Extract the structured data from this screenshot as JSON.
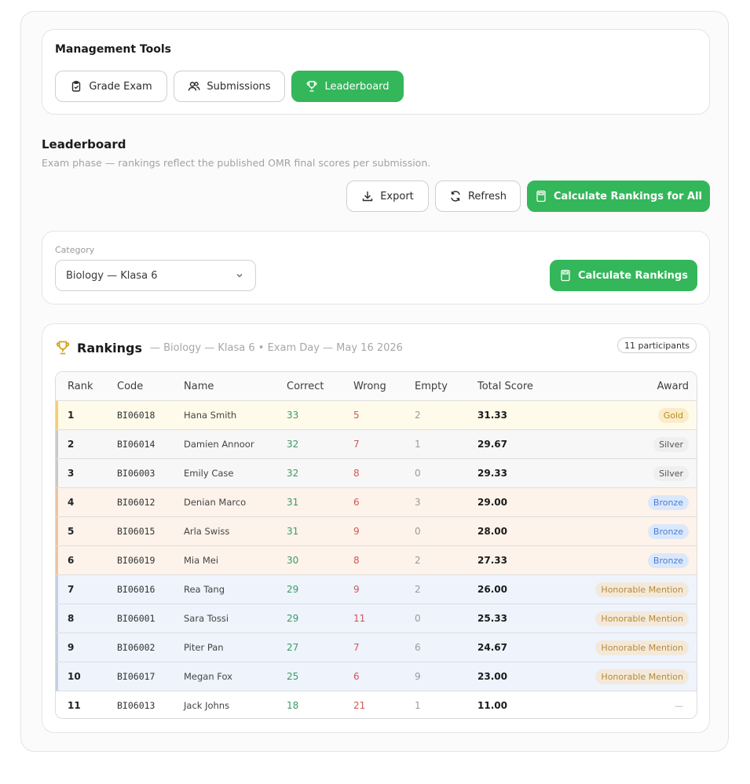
{
  "tools": {
    "title": "Management Tools",
    "grade_exam": "Grade Exam",
    "submissions": "Submissions",
    "leaderboard": "Leaderboard"
  },
  "leaderboard": {
    "title": "Leaderboard",
    "subtitle": "Exam phase — rankings reflect the published OMR final scores per submission.",
    "export": "Export",
    "refresh": "Refresh",
    "calc_all": "Calculate Rankings for All"
  },
  "category": {
    "label": "Category",
    "selected": "Biology — Klasa 6",
    "calc": "Calculate Rankings"
  },
  "rankings": {
    "title": "Rankings",
    "meta": "— Biology — Klasa 6 • Exam Day — May 16 2026",
    "participants": "11 participants",
    "columns": {
      "rank": "Rank",
      "code": "Code",
      "name": "Name",
      "correct": "Correct",
      "wrong": "Wrong",
      "empty": "Empty",
      "total": "Total Score",
      "award": "Award"
    },
    "rows": [
      {
        "rank": "1",
        "code": "BI06018",
        "name": "Hana Smith",
        "correct": "33",
        "wrong": "5",
        "empty": "2",
        "total": "31.33",
        "award": "Gold",
        "tier": "gold"
      },
      {
        "rank": "2",
        "code": "BI06014",
        "name": "Damien Annoor",
        "correct": "32",
        "wrong": "7",
        "empty": "1",
        "total": "29.67",
        "award": "Silver",
        "tier": "silver"
      },
      {
        "rank": "3",
        "code": "BI06003",
        "name": "Emily Case",
        "correct": "32",
        "wrong": "8",
        "empty": "0",
        "total": "29.33",
        "award": "Silver",
        "tier": "silver"
      },
      {
        "rank": "4",
        "code": "BI06012",
        "name": "Denian Marco",
        "correct": "31",
        "wrong": "6",
        "empty": "3",
        "total": "29.00",
        "award": "Bronze",
        "tier": "bronze"
      },
      {
        "rank": "5",
        "code": "BI06015",
        "name": "Arla Swiss",
        "correct": "31",
        "wrong": "9",
        "empty": "0",
        "total": "28.00",
        "award": "Bronze",
        "tier": "bronze"
      },
      {
        "rank": "6",
        "code": "BI06019",
        "name": "Mia Mei",
        "correct": "30",
        "wrong": "8",
        "empty": "2",
        "total": "27.33",
        "award": "Bronze",
        "tier": "bronze"
      },
      {
        "rank": "7",
        "code": "BI06016",
        "name": "Rea Tang",
        "correct": "29",
        "wrong": "9",
        "empty": "2",
        "total": "26.00",
        "award": "Honorable Mention",
        "tier": "hm"
      },
      {
        "rank": "8",
        "code": "BI06001",
        "name": "Sara Tossi",
        "correct": "29",
        "wrong": "11",
        "empty": "0",
        "total": "25.33",
        "award": "Honorable Mention",
        "tier": "hm"
      },
      {
        "rank": "9",
        "code": "BI06002",
        "name": "Piter Pan",
        "correct": "27",
        "wrong": "7",
        "empty": "6",
        "total": "24.67",
        "award": "Honorable Mention",
        "tier": "hm"
      },
      {
        "rank": "10",
        "code": "BI06017",
        "name": "Megan Fox",
        "correct": "25",
        "wrong": "6",
        "empty": "9",
        "total": "23.00",
        "award": "Honorable Mention",
        "tier": "hm"
      },
      {
        "rank": "11",
        "code": "BI06013",
        "name": "Jack Johns",
        "correct": "18",
        "wrong": "21",
        "empty": "1",
        "total": "11.00",
        "award": "—",
        "tier": "none"
      }
    ]
  },
  "colors": {
    "accent_green": "#34b65a",
    "gold_row": "#fffbea",
    "silver_row": "#f7f7f7",
    "bronze_row": "#fdf3ea",
    "hm_row": "#eef3fc"
  }
}
